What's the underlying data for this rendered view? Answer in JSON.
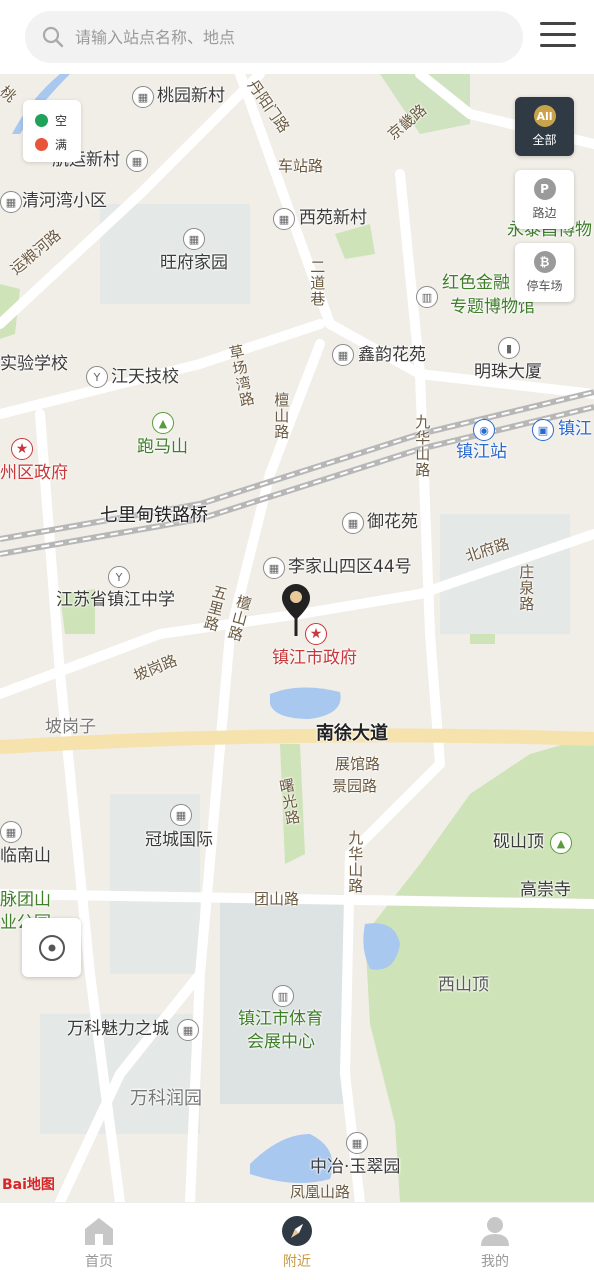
{
  "search": {
    "placeholder": "请输入站点名称、地点"
  },
  "legend": [
    {
      "label": "空",
      "color": "#1fa25a"
    },
    {
      "label": "满",
      "color": "#e8553a"
    }
  ],
  "filters": [
    {
      "icon_text": "All",
      "label": "全部",
      "active": true
    },
    {
      "icon_text": "P",
      "label": "路边",
      "active": false
    },
    {
      "icon_text": "₿",
      "label": "停车场",
      "active": false
    }
  ],
  "map": {
    "places": {
      "taoyuan": "桃园新村",
      "hangyun": "航运新村",
      "qinghewan": "清河湾小区",
      "xiyuan": "西苑新村",
      "wangfu": "旺府家园",
      "yongtai": "永泰昌博物",
      "hongse": "红色金融",
      "hongse2": "专题博物馆",
      "xinyun": "鑫韵花苑",
      "mingzhu": "明珠大厦",
      "shiyan": "实验学校",
      "jiangtian": "江天技校",
      "paomashan": "跑马山",
      "zhenjiangzhan": "镇江站",
      "zhenjiang_r": "镇江",
      "zhouqu": "州区政府",
      "qilidian": "七里甸铁路桥",
      "yuhuayuan": "御花苑",
      "lijiashan": "李家山四区44号",
      "zhongxue": "江苏省镇江中学",
      "shizhengfu": "镇江市政府",
      "pogangzi": "坡岗子",
      "nanxu": "南徐大道",
      "guancheng": "冠城国际",
      "linnanshan": "临南山",
      "yantou": "砚山顶",
      "gaochong": "高崇寺",
      "xishanding": "西山顶",
      "yuantuan": "脉团山",
      "yuantuan2": "业公园",
      "tiyu": "镇江市体育",
      "tiyu2": "会展中心",
      "wanke": "万科魅力之城",
      "wankerun": "万科润园",
      "zhongye": "中冶·玉翠园"
    },
    "roads": {
      "danyang": "丹阳门路",
      "jingji": "京畿路",
      "chezhan": "车站路",
      "yunliang": "运粮河路",
      "erdao": "二道巷",
      "caochang": "草场湾路",
      "tanshan": "檀山路",
      "jiuhua": "九华山路",
      "beifu": "北府路",
      "zhuangquan": "庄泉路",
      "wuli": "五里路",
      "tanshan2": "檀山路",
      "pogang": "坡岗路",
      "zhanguan": "展馆路",
      "jingyuan": "景园路",
      "shuguang": "曙光路",
      "jiuhua2": "九华山路",
      "tuanshan": "团山路",
      "fenghuang": "凤凰山路",
      "tao": "桃"
    },
    "brand": "Bai地图"
  },
  "nav": [
    {
      "label": "首页",
      "active": false
    },
    {
      "label": "附近",
      "active": true
    },
    {
      "label": "我的",
      "active": false
    }
  ]
}
